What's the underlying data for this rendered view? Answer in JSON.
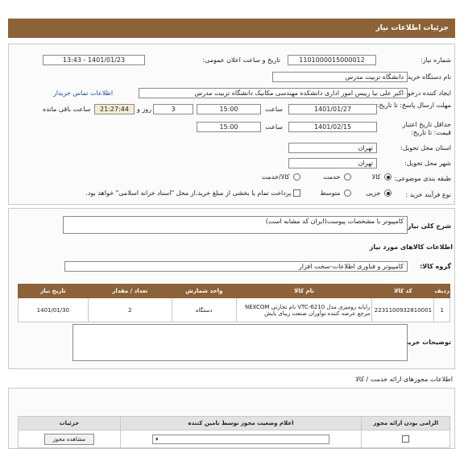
{
  "header": {
    "title": "جزئیات اطلاعات نیاز"
  },
  "need": {
    "number_label": "شماره نیاز:",
    "number_value": "1101000015000012",
    "announce_label": "تاریخ و ساعت اعلان عمومی:",
    "announce_value": "1401/01/23 - 13:43",
    "buyer_label": "نام دستگاه خریدار:",
    "buyer_value": "دانشگاه تربیت مدرس",
    "creator_label": "ایجاد کننده درخواست:",
    "creator_value": "اکبر علی نیا رییس امور اداری دانشکده مهندسی مکانیک دانشگاه تربیت مدرس",
    "contact_link": "اطلاعات تماس خریدار",
    "deadline_label": "مهلت ارسال پاسخ: تا تاریخ:",
    "deadline_date": "1401/01/27",
    "time_label": "ساعت",
    "deadline_time": "15:00",
    "days_value": "3",
    "days_label": "روز و",
    "remaining_time": "21:27:44",
    "remaining_label": "ساعت باقی مانده",
    "validity_label": "حداقل تاریخ اعتبار قیمت: تا تاریخ:",
    "validity_date": "1401/02/15",
    "validity_time_label": "ساعت",
    "validity_time": "15:00",
    "province_label": "استان محل تحویل:",
    "province_value": "تهران",
    "city_label": "شهر محل تحویل:",
    "city_value": "تهران",
    "category_label": "طبقه بندی موضوعی:",
    "category_options": [
      "کالا",
      "خدمت",
      "کالا/خدمت"
    ],
    "process_label": "نوع فرآیند خرید :",
    "process_options": [
      "جزیی",
      "متوسط"
    ],
    "process_note": "پرداخت تمام یا بخشی از مبلغ خرید،از محل \"اسناد خزانه اسلامی\" خواهد بود."
  },
  "summary": {
    "label": "شرح کلی نیاز:",
    "value": "کامپیوتر با مشخصات پیوست(ایران کد مشابه است)"
  },
  "goods": {
    "section_title": "اطلاعات کالاهای مورد نیاز",
    "group_label": "گروه کالا:",
    "group_value": "کامپیوتر و فناوری اطلاعات-سخت افزار",
    "columns": [
      "ردیف",
      "کد کالا",
      "نام کالا",
      "واحد شمارش",
      "تعداد / مقدار",
      "تاریخ نیاز"
    ],
    "rows": [
      {
        "row": "1",
        "code": "2231100932810001",
        "name": "رایانه رومیزی مدل VTC-6210 نام تجارتی NEXCOM مرجع عرضه کننده نوآوران صنعت زیبای پایش",
        "unit": "دستگاه",
        "qty": "2",
        "date": "1401/01/30"
      }
    ]
  },
  "notes": {
    "label": "توضیحات خریدار:"
  },
  "permits": {
    "section_title": "اطلاعات مجوزهای ارائه خدمت / کالا",
    "columns": [
      "الزامی بودن ارائه مجوز",
      "اعلام وضعیت مجوز توسط نامین کننده",
      "جزئیات"
    ],
    "view_button": "مشاهده مجوز"
  }
}
